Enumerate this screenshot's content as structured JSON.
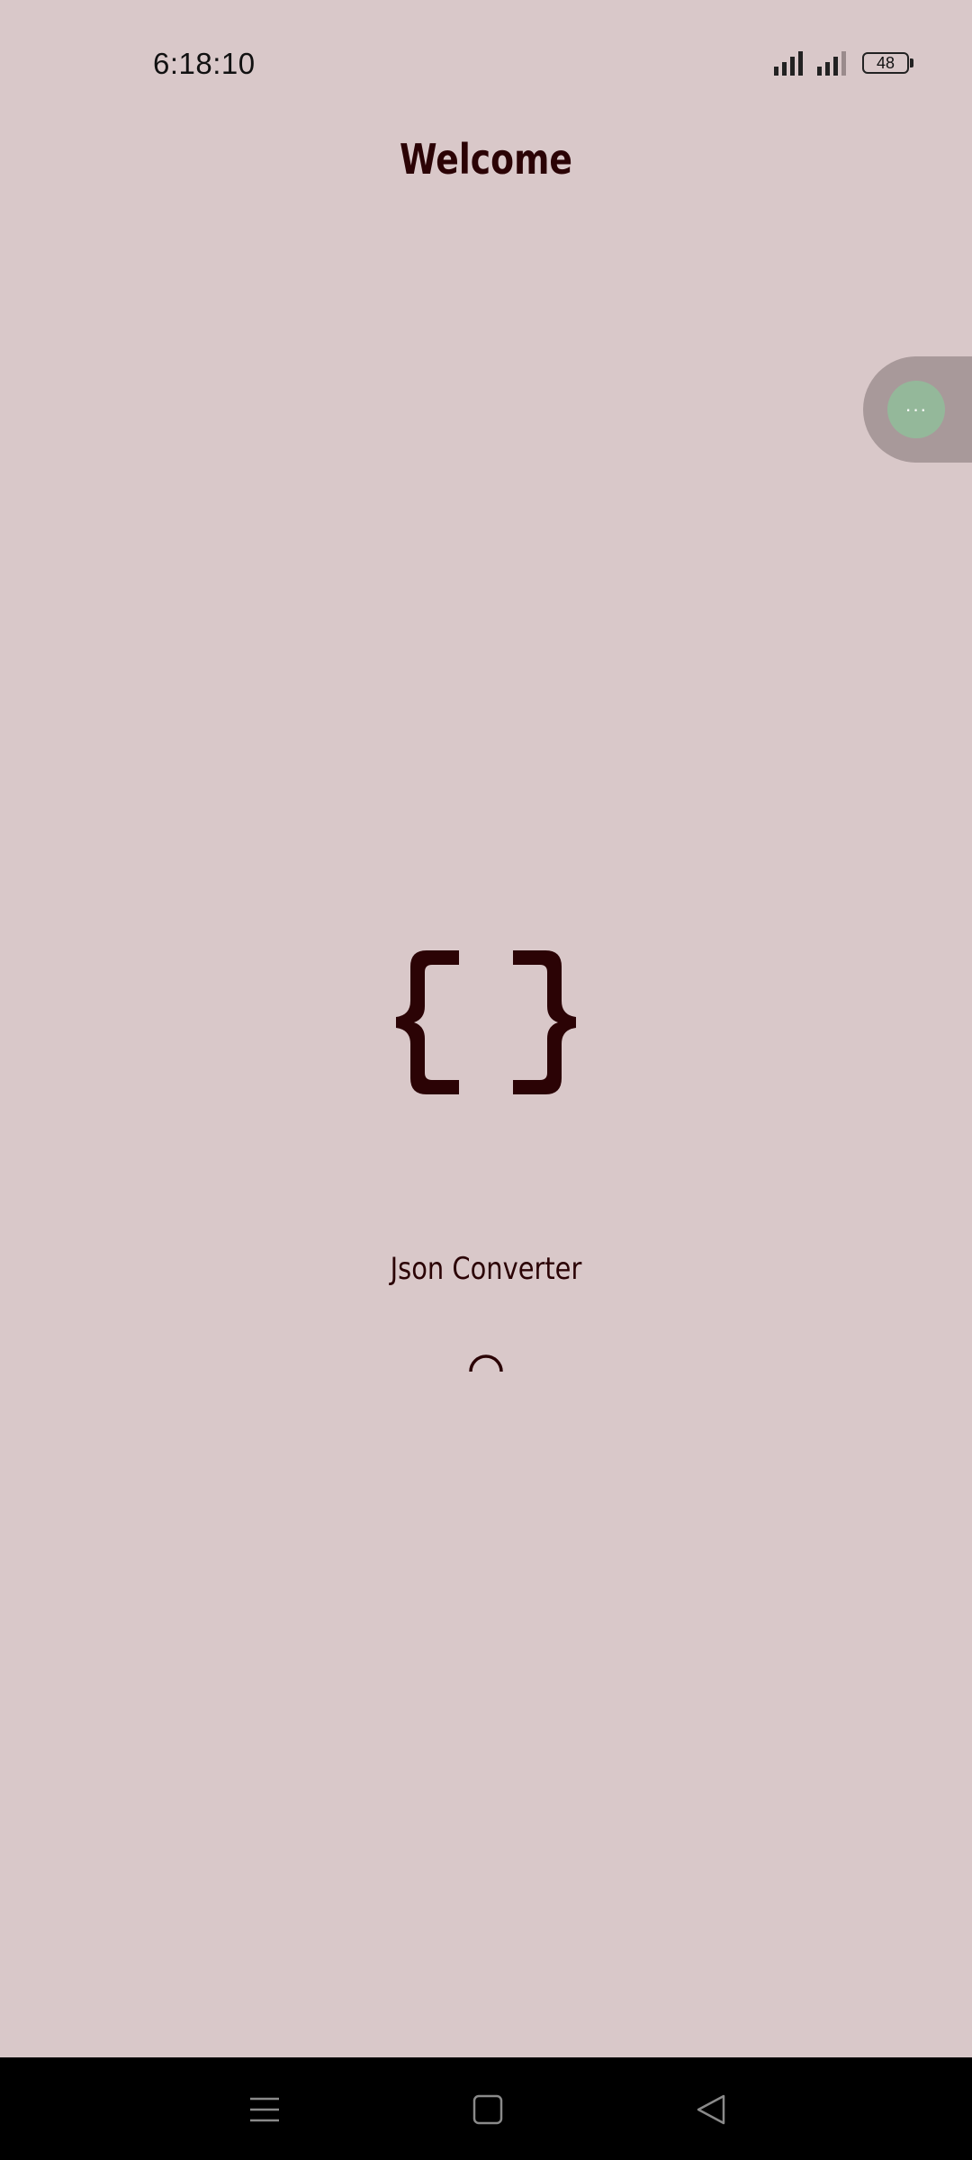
{
  "status_bar": {
    "time": "6:18:10",
    "battery_level": "48",
    "icons": [
      "signal-icon",
      "signal-icon",
      "battery-icon"
    ]
  },
  "header": {
    "title": "Welcome"
  },
  "floating_assistant": {
    "label": "···",
    "icon": "more-dots-icon"
  },
  "splash": {
    "logo_icon": "curly-braces-icon",
    "app_name": "Json Converter",
    "loading_icon": "loading-spinner-icon"
  },
  "nav_bar": {
    "icons": [
      "menu-icon",
      "home-icon",
      "back-icon"
    ]
  },
  "colors": {
    "background": "#d9c8c9",
    "primary_text": "#2b0305",
    "float_button": "#94b89a",
    "nav_background": "#000000"
  }
}
